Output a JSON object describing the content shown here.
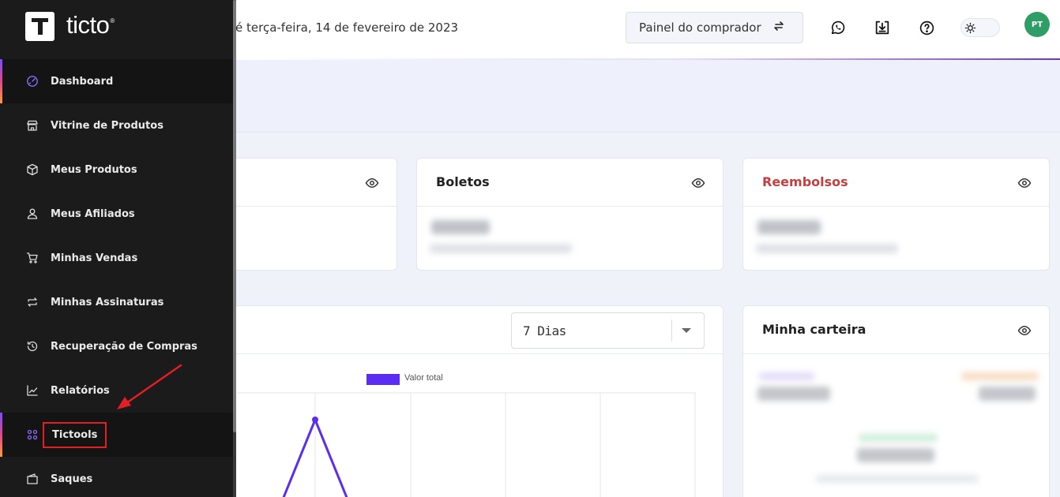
{
  "header": {
    "greeting": "é terça-feira, 14 de fevereiro de 2023",
    "buyer_panel_label": "Painel do comprador",
    "icons": [
      "whatsapp-icon",
      "download-icon",
      "help-icon",
      "sun-icon"
    ],
    "avatar_initials": "PT"
  },
  "sidebar": {
    "logo_text": "ticto",
    "logo_reg": "®",
    "items": [
      {
        "label": "Dashboard",
        "icon": "speedometer-icon"
      },
      {
        "label": "Vitrine de Produtos",
        "icon": "storefront-icon"
      },
      {
        "label": "Meus Produtos",
        "icon": "box-icon"
      },
      {
        "label": "Meus Afiliados",
        "icon": "users-icon"
      },
      {
        "label": "Minhas Vendas",
        "icon": "cart-icon"
      },
      {
        "label": "Minhas Assinaturas",
        "icon": "repeat-icon"
      },
      {
        "label": "Recuperação de Compras",
        "icon": "history-icon"
      },
      {
        "label": "Relatórios",
        "icon": "line-chart-icon"
      },
      {
        "label": "Tictools",
        "icon": "grid-icon"
      },
      {
        "label": "Saques",
        "icon": "wallet-icon"
      }
    ],
    "active_item": "Dashboard"
  },
  "cards": {
    "boletos_title": "Boletos",
    "reembolsos_title": "Reembolsos",
    "chart_period": "7 Dias",
    "wallet_title": "Minha carteira",
    "legend_label": "Valor total"
  },
  "colors": {
    "sidebar_bg": "#1b1b1b",
    "accent_purple": "#5a2df0",
    "refund_red": "#c43f3f",
    "highlight_red": "#e31e24",
    "avatar_green": "#2e9e66"
  }
}
